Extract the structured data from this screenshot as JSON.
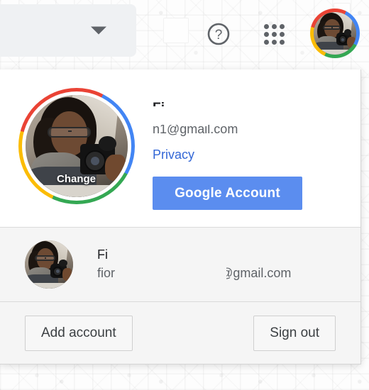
{
  "header": {
    "search_caret_icon": "chevron-down-icon",
    "help_icon": "help-question-icon",
    "help_glyph": "?",
    "apps_icon": "apps-grid-icon",
    "avatar_icon": "user-avatar-icon"
  },
  "account_popup": {
    "primary": {
      "name": "Fi",
      "email": "n1@gmail.com",
      "avatar_change_label": "Change",
      "privacy_label": "Privacy",
      "google_account_label": "Google Account"
    },
    "secondary": {
      "name": "Fi",
      "email_left": "fior",
      "email_right": "oh@gmail.com"
    },
    "footer": {
      "add_account_label": "Add account",
      "sign_out_label": "Sign out"
    }
  },
  "colors": {
    "google_blue": "#4285f4",
    "google_red": "#ea4335",
    "google_yellow": "#fbbc05",
    "google_green": "#34a853",
    "button_blue": "#5b8def",
    "link_blue": "#3367d6",
    "card_gray": "#f5f5f5"
  }
}
